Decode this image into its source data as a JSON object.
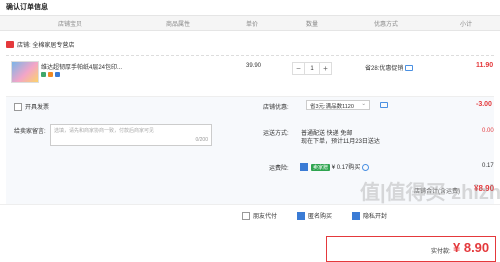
{
  "page_title": "确认订单信息",
  "header": {
    "shop_info": "店铺宝贝",
    "attrs": "商品属性",
    "unit_price": "单价",
    "quantity": "数量",
    "discount": "优惠方式",
    "subtotal": "小计"
  },
  "shop": {
    "label": "店铺: 全棉家居专营店"
  },
  "item": {
    "name": "维达超韧厚手帕纸4层24包印...",
    "price": "39.90",
    "quantity": "1",
    "promo": "省28:优惠促销",
    "subtotal": "11.90"
  },
  "invoice": {
    "label": "开具发票"
  },
  "shop_discount": {
    "label": "店铺优惠:",
    "value": "省3元:满品数1120",
    "amount": "-3.00"
  },
  "message": {
    "label": "给卖家留言:",
    "placeholder": "选填，请先和商家协商一致，付款后商家可见",
    "counter": "0/200"
  },
  "shipping": {
    "label": "运送方式:",
    "line1": "普通配送 快递 免邮",
    "line2": "现在下单，预计11月23日送达",
    "amount": "0.00"
  },
  "insurance": {
    "label": "运费险:",
    "tag": "卖家赠",
    "value": "¥ 0.17购买",
    "amount": "0.17"
  },
  "store_total": {
    "label": "店铺合计(含运费)",
    "amount": "¥8.90"
  },
  "footer": {
    "friend_pay": "朋友代付",
    "anonymous": "匿名购买",
    "extra": "隐私开封"
  },
  "pay": {
    "label": "实付款:",
    "amount": "¥ 8.90"
  },
  "watermark": "值|值得买 zhizhizhi.com",
  "colors": {
    "accent": "#e4393c",
    "blue": "#3a7bd5",
    "green": "#2ea44f"
  }
}
